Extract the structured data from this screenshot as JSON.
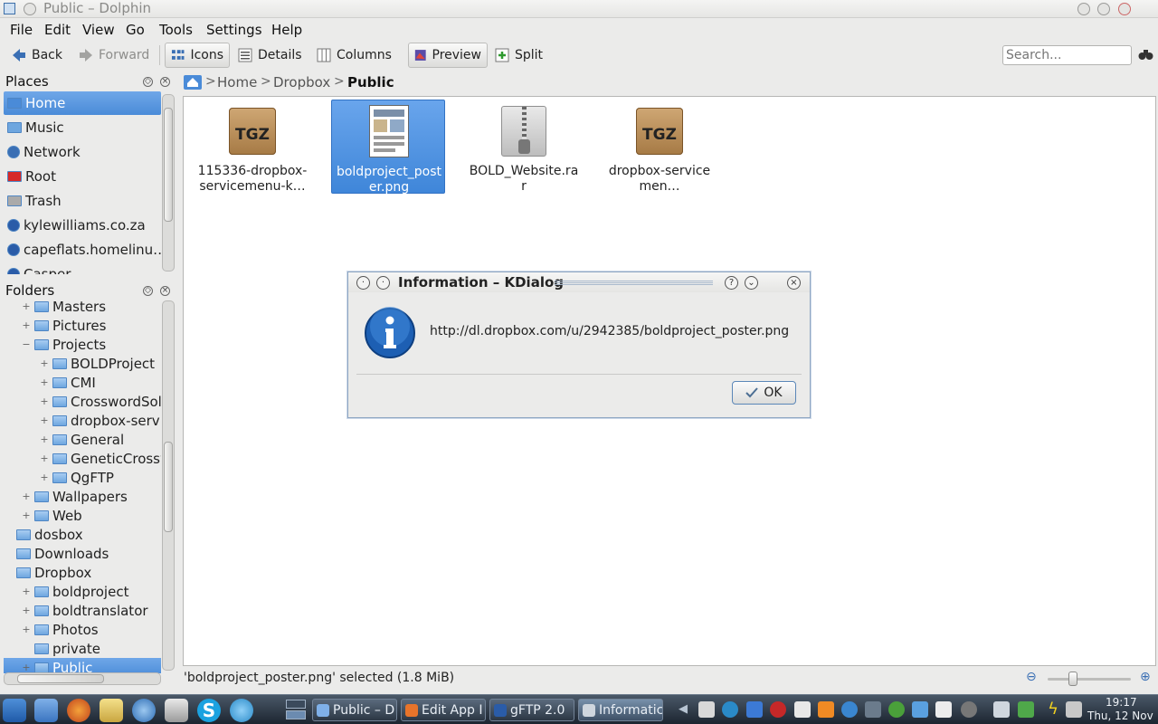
{
  "window": {
    "title": "Public – Dolphin"
  },
  "menubar": {
    "file": "File",
    "edit": "Edit",
    "view": "View",
    "go": "Go",
    "tools": "Tools",
    "settings": "Settings",
    "help": "Help"
  },
  "toolbar": {
    "back": "Back",
    "forward": "Forward",
    "icons": "Icons",
    "details": "Details",
    "columns": "Columns",
    "preview": "Preview",
    "split": "Split",
    "search_placeholder": "Search..."
  },
  "places": {
    "title": "Places",
    "items": [
      {
        "label": "Home",
        "icon": "home-icon",
        "selected": true
      },
      {
        "label": "Music",
        "icon": "folder-icon"
      },
      {
        "label": "Network",
        "icon": "network-icon"
      },
      {
        "label": "Root",
        "icon": "root-folder-icon"
      },
      {
        "label": "Trash",
        "icon": "trash-icon"
      },
      {
        "label": "kylewilliams.co.za",
        "icon": "globe-icon"
      },
      {
        "label": "capeflats.homelinu…",
        "icon": "globe-icon"
      },
      {
        "label": "Casper",
        "icon": "globe-icon"
      }
    ]
  },
  "folders": {
    "title": "Folders",
    "rows": [
      {
        "label": "Masters",
        "depth": 1,
        "exp": "+"
      },
      {
        "label": "Pictures",
        "depth": 1,
        "exp": "+"
      },
      {
        "label": "Projects",
        "depth": 1,
        "exp": "−"
      },
      {
        "label": "BOLDProject",
        "depth": 2,
        "exp": "+"
      },
      {
        "label": "CMI",
        "depth": 2,
        "exp": "+"
      },
      {
        "label": "CrosswordSolve",
        "depth": 2,
        "exp": "+"
      },
      {
        "label": "dropbox-service",
        "depth": 2,
        "exp": "+"
      },
      {
        "label": "General",
        "depth": 2,
        "exp": "+"
      },
      {
        "label": "GeneticCrosswc",
        "depth": 2,
        "exp": "+"
      },
      {
        "label": "QgFTP",
        "depth": 2,
        "exp": "+"
      },
      {
        "label": "Wallpapers",
        "depth": 1,
        "exp": "+"
      },
      {
        "label": "Web",
        "depth": 1,
        "exp": "+"
      },
      {
        "label": "dosbox",
        "depth": 0,
        "exp": ""
      },
      {
        "label": "Downloads",
        "depth": 0,
        "exp": ""
      },
      {
        "label": "Dropbox",
        "depth": 0,
        "exp": ""
      },
      {
        "label": "boldproject",
        "depth": 1,
        "exp": "+"
      },
      {
        "label": "boldtranslator",
        "depth": 1,
        "exp": "+"
      },
      {
        "label": "Photos",
        "depth": 1,
        "exp": "+"
      },
      {
        "label": "private",
        "depth": 1,
        "exp": ""
      },
      {
        "label": "Public",
        "depth": 1,
        "exp": "+",
        "selected": true
      }
    ]
  },
  "breadcrumb": {
    "home": "Home",
    "dropbox": "Dropbox",
    "current": "Public",
    "sep": ">"
  },
  "files": [
    {
      "name": "115336-dropbox-servicemenu-k…",
      "type": "tgz",
      "badge": "TGZ"
    },
    {
      "name": "boldproject_poster.png",
      "type": "image",
      "selected": true
    },
    {
      "name": "BOLD_Website.rar",
      "type": "rar"
    },
    {
      "name": "dropbox-servicemen…",
      "type": "tgz",
      "badge": "TGZ"
    }
  ],
  "status": {
    "text": "'boldproject_poster.png' selected (1.8 MiB)",
    "zoom_level": 0.3
  },
  "dialog": {
    "title": "Information – KDialog",
    "message": "http://dl.dropbox.com/u/2942385/boldproject_poster.png",
    "ok": "OK"
  },
  "taskbar": {
    "tasks": [
      {
        "label": "Public – D",
        "icon": "dolphin-icon"
      },
      {
        "label": "Edit App I",
        "icon": "firefox-icon"
      },
      {
        "label": "gFTP 2.0",
        "icon": "gftp-icon"
      },
      {
        "label": "Informatic",
        "icon": "gear-icon",
        "active": true
      }
    ],
    "clock_time": "19:17",
    "clock_date": "Thu, 12 Nov"
  },
  "colors": {
    "selection": "#4a8bd8",
    "taskbar": "#2c3744"
  }
}
